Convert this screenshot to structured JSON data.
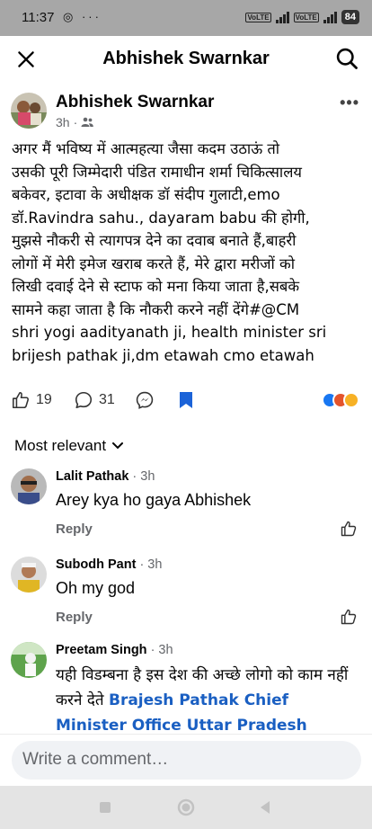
{
  "status": {
    "time": "11:37",
    "icons": "◎ ···",
    "battery": "84"
  },
  "header": {
    "title": "Abhishek Swarnkar",
    "close_icon": "close-icon",
    "search_icon": "search-icon"
  },
  "post": {
    "author": "Abhishek Swarnkar",
    "time": "3h",
    "audience_icon": "friends-icon",
    "lines": [
      "अगर मैं भविष्य में आत्महत्या जैसा कदम उठाऊं तो",
      "उसकी पूरी जिम्मेदारी पंडित रामाधीन शर्मा चिकित्सालय",
      "बकेवर, इटावा के अधीक्षक डॉ संदीप गुलाटी,emo",
      "डॉ.Ravindra sahu., dayaram babu   की होगी,",
      "मुझसे नौकरी से त्यागपत्र देने का दवाब बनाते हैं,बाहरी",
      "लोगों में मेरी इमेज खराब करते हैं, मेरे द्वारा मरीजों को",
      "लिखी दवाई देने से स्टाफ को मना किया जाता है,सबके",
      "सामने कहा जाता है कि नौकरी करने नहीं देंगे#@CM",
      "shri yogi aadityanath ji, health minister sri",
      "brijesh pathak ji,dm etawah cmo etawah"
    ],
    "likes": "19",
    "comments": "31"
  },
  "sort_label": "Most relevant",
  "comments": [
    {
      "name": "Lalit Pathak",
      "time": "· 3h",
      "text": "Arey kya ho gaya Abhishek",
      "reply": "Reply"
    },
    {
      "name": "Subodh Pant",
      "time": "· 3h",
      "text": "Oh my god",
      "reply": "Reply"
    },
    {
      "name": "Preetam Singh",
      "time": "· 3h",
      "text": "यही विडम्बना है इस देश की अच्छे लोगो को काम नहीं करने देते",
      "link": "Brajesh Pathak Chief Minister Office Uttar Pradesh"
    }
  ],
  "composer_placeholder": "Write a comment…",
  "colors": {
    "accent": "#1a5fc2",
    "bookmark": "#1b63d8",
    "status_bar": "#a7a7a7"
  }
}
